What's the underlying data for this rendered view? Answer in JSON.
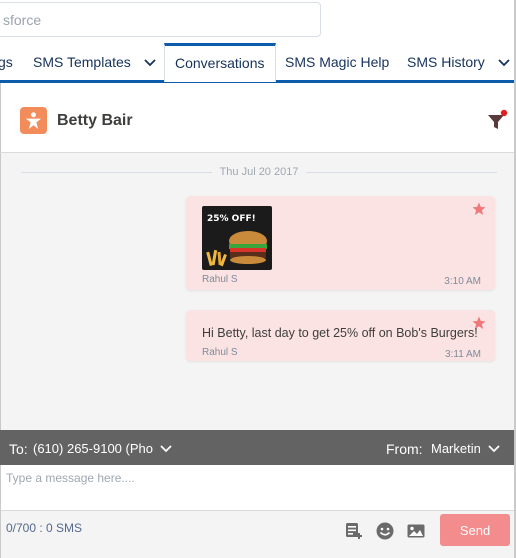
{
  "search": {
    "value": "sforce"
  },
  "tabs": [
    {
      "label": "gs",
      "has_menu": false,
      "active": false
    },
    {
      "label": "SMS Templates",
      "has_menu": true,
      "active": false
    },
    {
      "label": "Conversations",
      "has_menu": false,
      "active": true
    },
    {
      "label": "SMS Magic Help",
      "has_menu": false,
      "active": false
    },
    {
      "label": "SMS History",
      "has_menu": true,
      "active": false
    }
  ],
  "contact": {
    "name": "Betty Bair",
    "avatar_icon": "contact-star-icon"
  },
  "conversation": {
    "date_separator": "Thu Jul 20 2017",
    "messages": [
      {
        "type": "mms",
        "image_caption": "25% OFF!",
        "sender": "Rahul S",
        "time": "3:10 AM"
      },
      {
        "type": "sms",
        "text": "Hi Betty, last day to get 25% off on Bob's Burgers!",
        "sender": "Rahul S",
        "time": "3:11 AM"
      }
    ]
  },
  "recipient": {
    "to_label": "To:",
    "to_value": "(610) 265-9100 (Pho",
    "from_label": "From:",
    "from_value": "Marketin"
  },
  "composer": {
    "placeholder": "Type a message here....",
    "counter": "0/700 : 0 SMS",
    "send_label": "Send"
  },
  "colors": {
    "accent": "#0b5cab",
    "bubble": "#fbe3e3",
    "star": "#f07878",
    "send": "#f38c8c",
    "avatar": "#f38c5b",
    "to_bar": "#636363"
  }
}
